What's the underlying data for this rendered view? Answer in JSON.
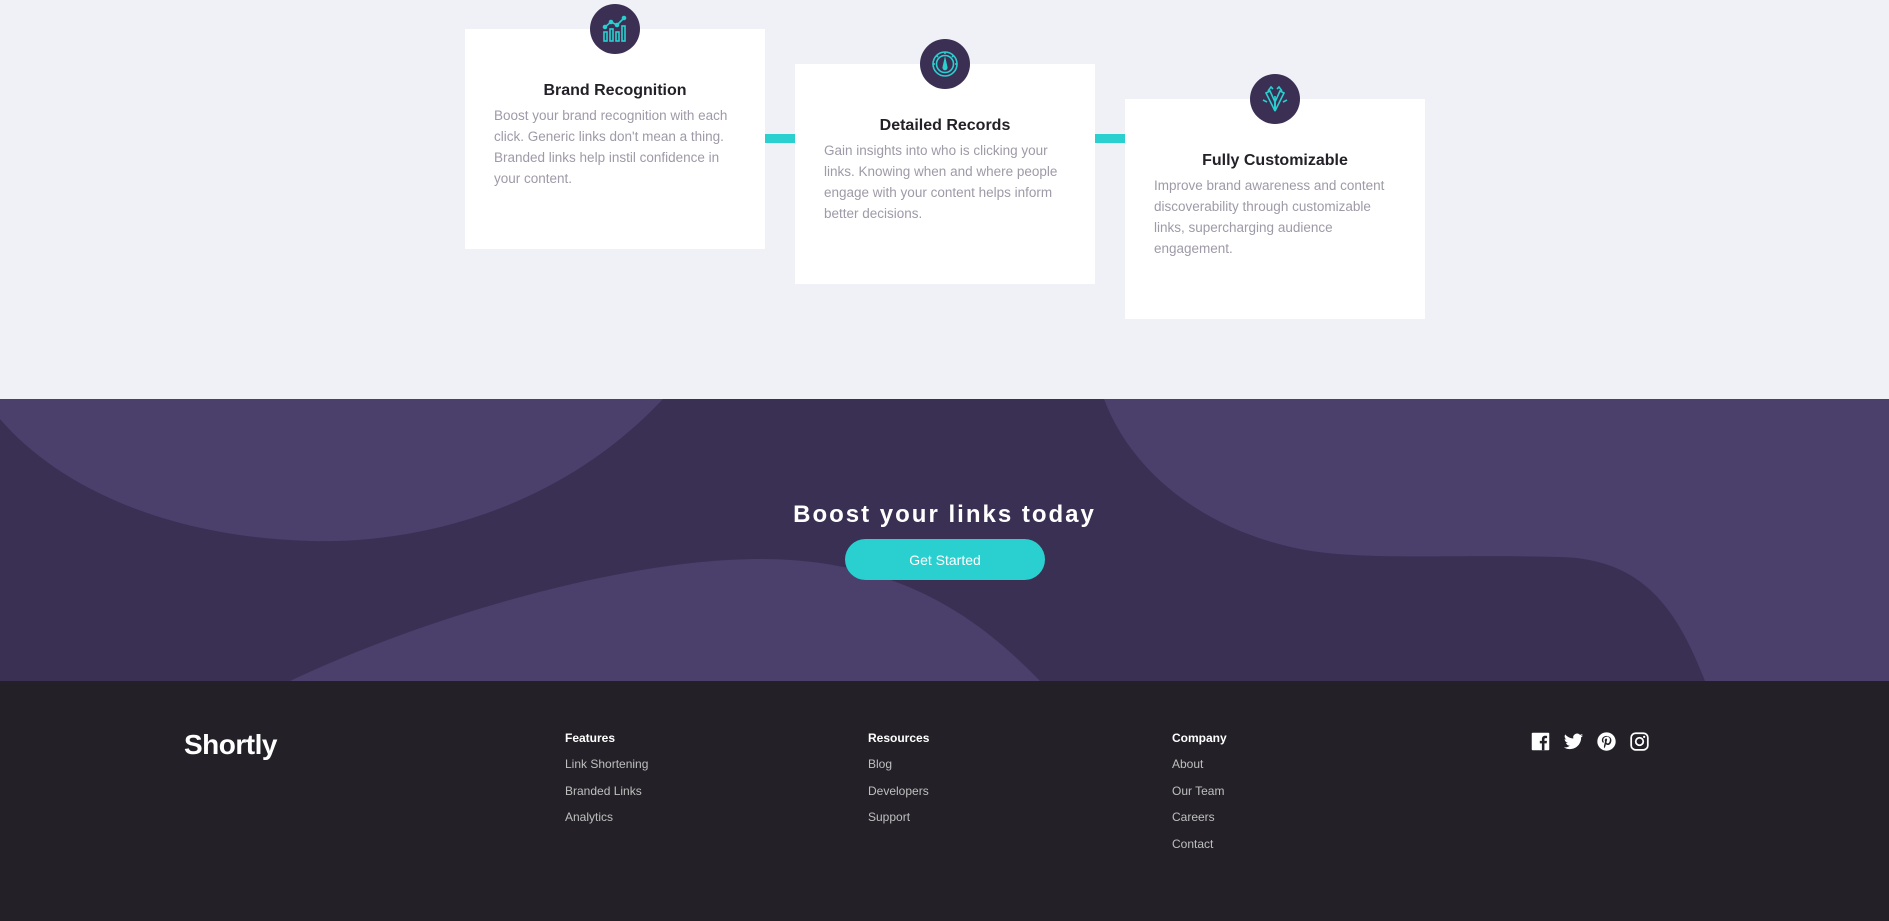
{
  "features": {
    "cards": [
      {
        "icon": "bar-chart-icon",
        "title": "Brand Recognition",
        "text": "Boost your brand recognition with each click. Generic links don't mean a thing. Branded links help instil confidence in your content."
      },
      {
        "icon": "speedometer-icon",
        "title": "Detailed Records",
        "text": "Gain insights into who is clicking your links. Knowing when and where people engage with your content helps inform better decisions."
      },
      {
        "icon": "brushes-icon",
        "title": "Fully Customizable",
        "text": "Improve brand awareness and content discoverability through customizable links, supercharging audience engagement."
      }
    ]
  },
  "boost": {
    "heading": "Boost your links today",
    "button_label": "Get Started"
  },
  "footer": {
    "logo": "Shortly",
    "columns": [
      {
        "heading": "Features",
        "links": [
          "Link Shortening",
          "Branded Links",
          "Analytics"
        ]
      },
      {
        "heading": "Resources",
        "links": [
          "Blog",
          "Developers",
          "Support"
        ]
      },
      {
        "heading": "Company",
        "links": [
          "About",
          "Our Team",
          "Careers",
          "Contact"
        ]
      }
    ],
    "social": [
      "facebook-icon",
      "twitter-icon",
      "pinterest-icon",
      "instagram-icon"
    ]
  },
  "colors": {
    "cyan": "#2acfcf",
    "dark_violet": "#3b3054",
    "very_dark_violet": "#232127",
    "grayish_violet": "#9e9aa7",
    "light_background": "#eff1f7"
  }
}
